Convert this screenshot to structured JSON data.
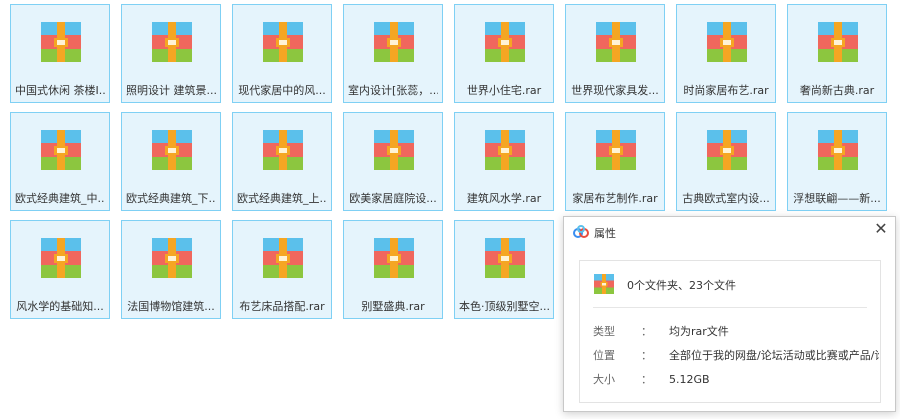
{
  "files": [
    "中国式休闲 茶楼I...",
    "照明设计   建筑景...",
    "现代家居中的风...",
    "室内设计[张蕊，...",
    "世界小住宅.rar",
    "世界现代家具发...",
    "时尚家居布艺.rar",
    "奢尚新古典.rar",
    "欧式经典建筑_中...",
    "欧式经典建筑_下...",
    "欧式经典建筑_上...",
    "欧美家居庭院设...",
    "建筑风水学.rar",
    "家居布艺制作.rar",
    "古典欧式室内设...",
    "浮想联翩——新...",
    "风水学的基础知...",
    "法国博物馆建筑...",
    "布艺床品搭配.rar",
    "别墅盛典.rar",
    "本色·顶级别墅空..."
  ],
  "dialog": {
    "title": "属性",
    "close_glyph": "✕",
    "summary": "0个文件夹、23个文件",
    "type_label": "类型",
    "type_value": "均为rar文件",
    "location_label": "位置",
    "location_value": "全部位于我的网盘/论坛活动或比赛或产品/论坛...",
    "size_label": "大小",
    "size_value": "5.12GB",
    "colon": "："
  },
  "colors": {
    "tile_bg": "#e5f4fc",
    "tile_border": "#7fd0f4",
    "rar_blue": "#5bc0eb",
    "rar_red": "#f0675d",
    "rar_green": "#8cc63f",
    "rar_band": "#f5a623"
  },
  "icons": {
    "file": "rar-archive-icon",
    "dialog_title": "baidu-netdisk-cloud-icon",
    "close": "close-icon"
  }
}
